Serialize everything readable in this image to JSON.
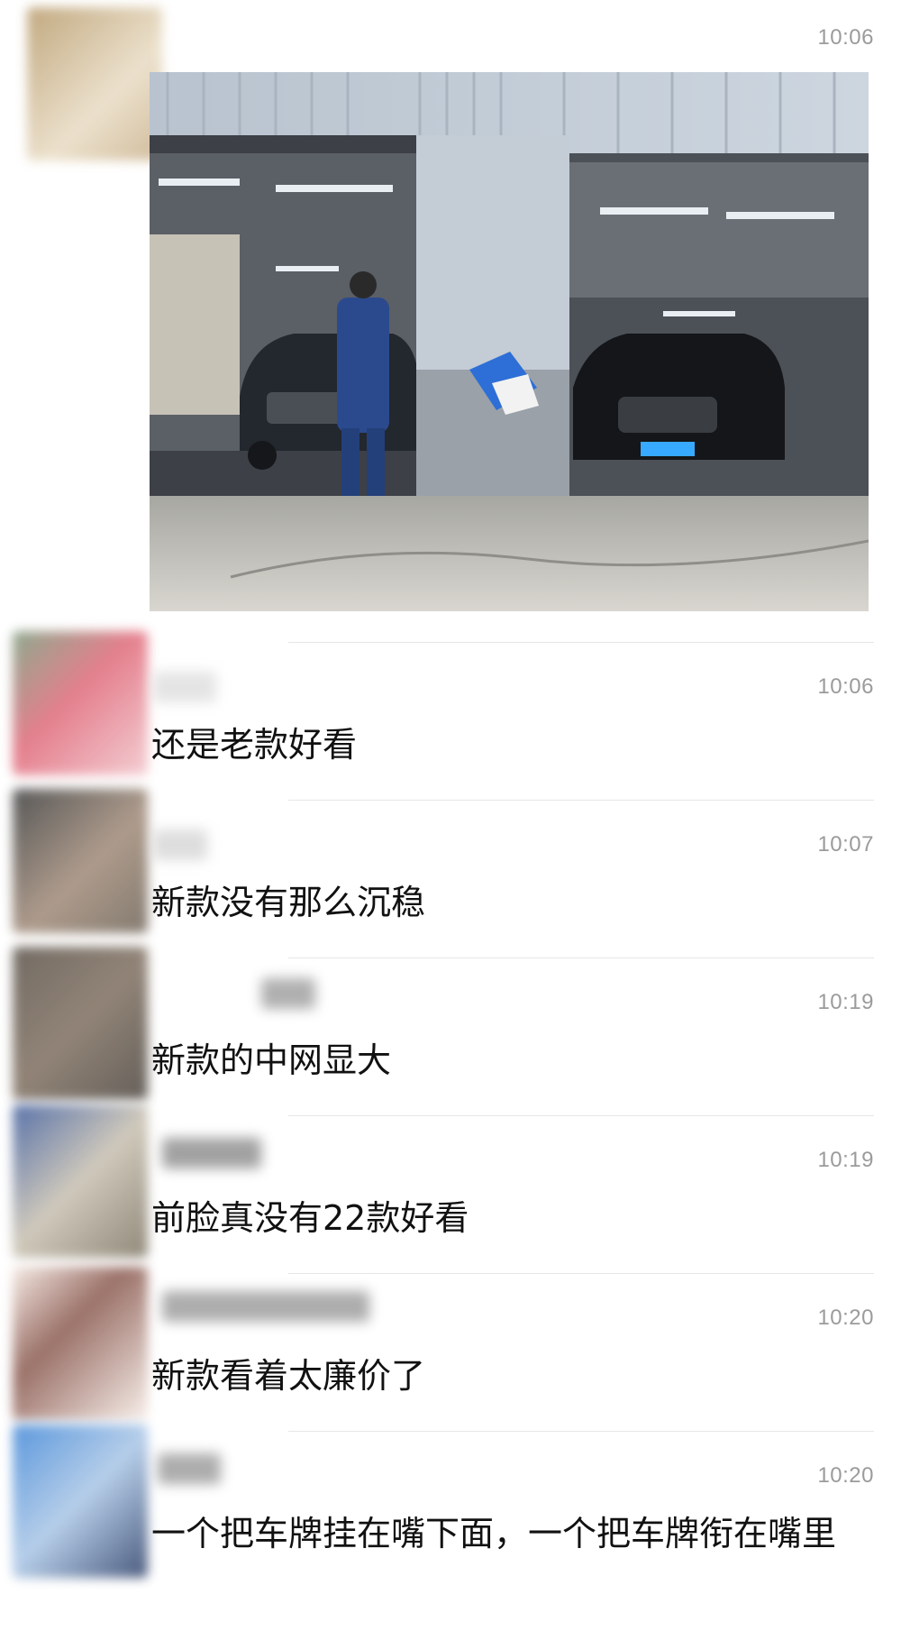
{
  "post": {
    "time": "10:06",
    "photo_icon": "photo-garage-two-suvs"
  },
  "comments": [
    {
      "time": "10:06",
      "text": "还是老款好看"
    },
    {
      "time": "10:07",
      "text": "新款没有那么沉稳"
    },
    {
      "time": "10:19",
      "text": "新款的中网显大"
    },
    {
      "time": "10:19",
      "text": "前脸真没有22款好看"
    },
    {
      "time": "10:20",
      "text": "新款看着太廉价了"
    },
    {
      "time": "10:20",
      "text": "一个把车牌挂在嘴下面，一个把车牌衔在嘴里"
    }
  ],
  "colors": {
    "text": "#111111",
    "time": "#9b9b9b",
    "divider": "#e6e6e6"
  }
}
